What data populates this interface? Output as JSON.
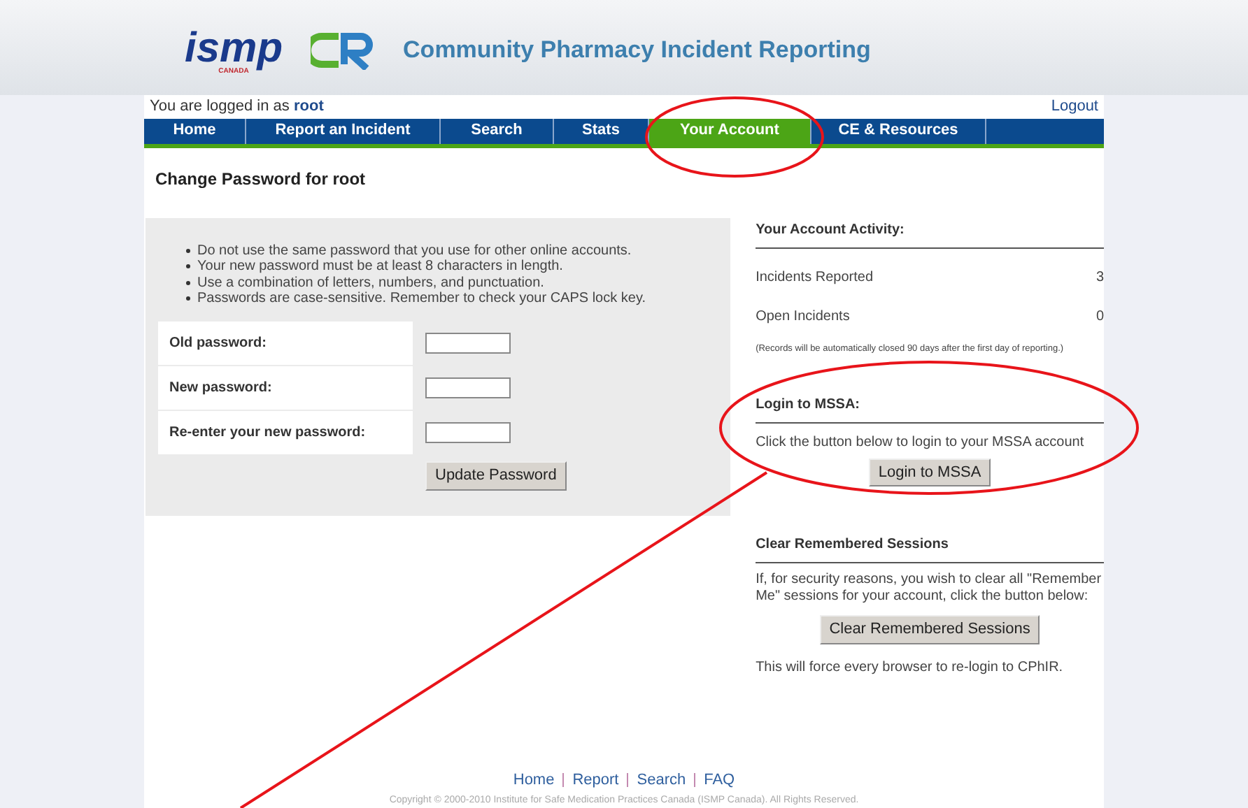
{
  "header": {
    "logo_text": "ismp",
    "logo_subtext": "CANADA",
    "site_title": "Community Pharmacy Incident Reporting"
  },
  "user_bar": {
    "prefix": "You are logged in as",
    "username": "root",
    "logout": "Logout"
  },
  "nav": [
    {
      "label": "Home",
      "selected": false
    },
    {
      "label": "Report an Incident",
      "selected": false
    },
    {
      "label": "Search",
      "selected": false
    },
    {
      "label": "Stats",
      "selected": false
    },
    {
      "label": "Your Account",
      "selected": true
    },
    {
      "label": "CE & Resources",
      "selected": false
    }
  ],
  "page_title": "Change Password for root",
  "rules": [
    "Do not use the same password that you use for other online accounts.",
    "Your new password must be at least 8 characters in length.",
    "Use a combination of letters, numbers, and punctuation.",
    "Passwords are case-sensitive. Remember to check your CAPS lock key."
  ],
  "fields": [
    {
      "label": "Old password:"
    },
    {
      "label": "New password:"
    },
    {
      "label": "Re-enter your new password:"
    }
  ],
  "update_button": "Update Password",
  "activity": {
    "heading": "Your Account Activity:",
    "rows": [
      {
        "label": "Incidents Reported",
        "value": "3"
      },
      {
        "label": "Open Incidents",
        "value": "0"
      }
    ],
    "note": "(Records will be automatically closed 90 days after the first day of reporting.)"
  },
  "mssa": {
    "heading": "Login to MSSA:",
    "text": "Click the button below to login to your MSSA account",
    "button": "Login to MSSA"
  },
  "sessions": {
    "heading": "Clear Remembered Sessions",
    "text": "If, for security reasons, you wish to clear all \"Remember Me\" sessions for your account, click the button below:",
    "button": "Clear Remembered Sessions",
    "note": "This will force every browser to re-login to CPhIR."
  },
  "footer": {
    "links": [
      "Home",
      "Report",
      "Search",
      "FAQ"
    ],
    "copyright": "Copyright © 2000-2010 Institute for Safe Medication Practices Canada (ISMP Canada). All Rights Reserved."
  }
}
